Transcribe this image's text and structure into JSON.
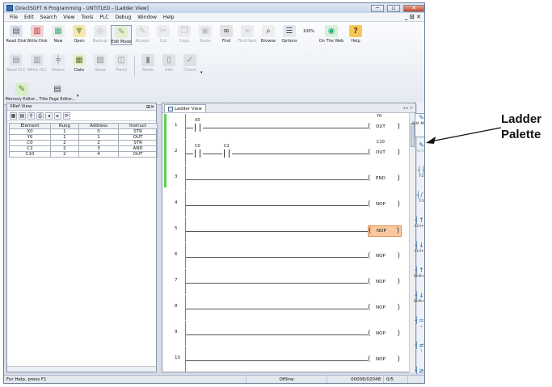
{
  "window": {
    "title": "DirectSOFT 6 Programming - UNTITLED - [Ladder View]",
    "min": "─",
    "max": "▫",
    "close": "✕"
  },
  "menu": [
    "File",
    "Edit",
    "Search",
    "View",
    "Tools",
    "PLC",
    "Debug",
    "Window",
    "Help"
  ],
  "mdi": "_ ⊡ ✕",
  "toolbar1": [
    {
      "label": "Read Disk",
      "icon": "read-disk-icon",
      "enabled": true
    },
    {
      "label": "Write Disk",
      "icon": "write-disk-icon",
      "enabled": true
    },
    {
      "label": "New",
      "icon": "new-icon",
      "enabled": true
    },
    {
      "label": "Open",
      "icon": "open-icon",
      "enabled": true
    },
    {
      "label": "Backup",
      "icon": "backup-icon",
      "enabled": false
    },
    {
      "label": "Edit Mode",
      "icon": "edit-mode-icon",
      "enabled": true,
      "selected": true
    },
    {
      "label": "Accept",
      "icon": "accept-icon",
      "enabled": false
    },
    {
      "label": "Cut",
      "icon": "cut-icon",
      "enabled": false
    },
    {
      "label": "Copy",
      "icon": "copy-icon",
      "enabled": false
    },
    {
      "label": "Paste",
      "icon": "paste-icon",
      "enabled": false
    },
    {
      "label": "Find",
      "icon": "find-icon",
      "enabled": true
    },
    {
      "label": "Find Next",
      "icon": "find-next-icon",
      "enabled": false
    },
    {
      "label": "Browse",
      "icon": "browse-icon",
      "enabled": true
    },
    {
      "label": "Options",
      "icon": "options-icon",
      "enabled": true
    },
    {
      "label": "100%",
      "icon": "zoom-icon",
      "enabled": true
    },
    {
      "label": "On The Web",
      "icon": "web-icon",
      "enabled": true
    },
    {
      "label": "Help",
      "icon": "help-icon",
      "enabled": true
    }
  ],
  "toolbar2": [
    {
      "label": "Read PLC",
      "icon": "read-plc-icon",
      "enabled": false
    },
    {
      "label": "Write PLC",
      "icon": "write-plc-icon",
      "enabled": false
    },
    {
      "label": "Status",
      "icon": "status-icon",
      "enabled": false
    },
    {
      "label": "Data",
      "icon": "data-icon",
      "enabled": true
    },
    {
      "label": "Value",
      "icon": "value-icon",
      "enabled": false
    },
    {
      "label": "Trend",
      "icon": "trend-icon",
      "enabled": false
    },
    {
      "label": "Mode",
      "icon": "mode-icon",
      "enabled": false
    },
    {
      "label": "Info",
      "icon": "info-icon",
      "enabled": false
    },
    {
      "label": "Check",
      "icon": "check-icon",
      "enabled": false
    }
  ],
  "toolbar3": [
    {
      "label": "Memory Editor...",
      "icon": "memory-editor-icon",
      "enabled": true
    },
    {
      "label": "Title Page Editor...",
      "icon": "title-page-icon",
      "enabled": true
    }
  ],
  "xref": {
    "title": "XRef View",
    "columns": [
      "Element",
      "Rung",
      "Address",
      "Instruct"
    ],
    "rows": [
      [
        "X0",
        "1",
        "0",
        "STR"
      ],
      [
        "Y0",
        "1",
        "1",
        "OUT"
      ],
      [
        "C0",
        "2",
        "2",
        "STR"
      ],
      [
        "C2",
        "2",
        "3",
        "AND"
      ],
      [
        "C10",
        "2",
        "4",
        "OUT"
      ]
    ]
  },
  "ladder": {
    "tab": "Ladder View",
    "rungs": [
      {
        "n": "1",
        "contacts": [
          "X0"
        ],
        "coil": "OUT",
        "coil_label": "Y0"
      },
      {
        "n": "2",
        "contacts": [
          "C0",
          "C2"
        ],
        "coil": "OUT",
        "coil_label": "C10"
      },
      {
        "n": "3",
        "contacts": [],
        "coil": "END",
        "coil_label": ""
      },
      {
        "n": "4",
        "contacts": [],
        "coil": "NOP",
        "coil_label": ""
      },
      {
        "n": "5",
        "contacts": [],
        "coil": "NOP",
        "coil_label": "",
        "highlight": true
      },
      {
        "n": "6",
        "contacts": [],
        "coil": "NOP",
        "coil_label": ""
      },
      {
        "n": "7",
        "contacts": [],
        "coil": "NOP",
        "coil_label": ""
      },
      {
        "n": "8",
        "contacts": [],
        "coil": "NOP",
        "coil_label": ""
      },
      {
        "n": "9",
        "contacts": [],
        "coil": "NOP",
        "coil_label": ""
      },
      {
        "n": "10",
        "contacts": [],
        "coil": "NOP",
        "coil_label": ""
      }
    ]
  },
  "palette": [
    {
      "label": "Edit Mode",
      "glyph": "✎",
      "enabled": true
    },
    {
      "label": "Accept",
      "glyph": "✎",
      "enabled": false
    },
    {
      "label": "F2",
      "glyph": "┤├",
      "enabled": true
    },
    {
      "label": "F3",
      "glyph": "┤/├",
      "enabled": true
    },
    {
      "label": "Ctrl+F2",
      "glyph": "┤↑├",
      "enabled": true
    },
    {
      "label": "Ctrl+F3",
      "glyph": "┤↓├",
      "enabled": true
    },
    {
      "label": "Shift+F2",
      "glyph": "┤↑├",
      "enabled": true
    },
    {
      "label": "Shift+F3",
      "glyph": "┤↓├",
      "enabled": true
    },
    {
      "label": "=",
      "glyph": "┤=├",
      "enabled": true
    },
    {
      "label": "!",
      "glyph": "┤≠├",
      "enabled": true
    },
    {
      "label": ">",
      "glyph": "┤≥├",
      "enabled": true
    }
  ],
  "status": {
    "help": "For Help, press F1",
    "mode": "Offline",
    "count": "00006/02048",
    "pos": "0/5"
  },
  "annotation": {
    "line1": "Ladder",
    "line2": "Palette"
  },
  "colors": {
    "highlight": "#f8c9a0",
    "green_bar": "#5ad04a"
  }
}
